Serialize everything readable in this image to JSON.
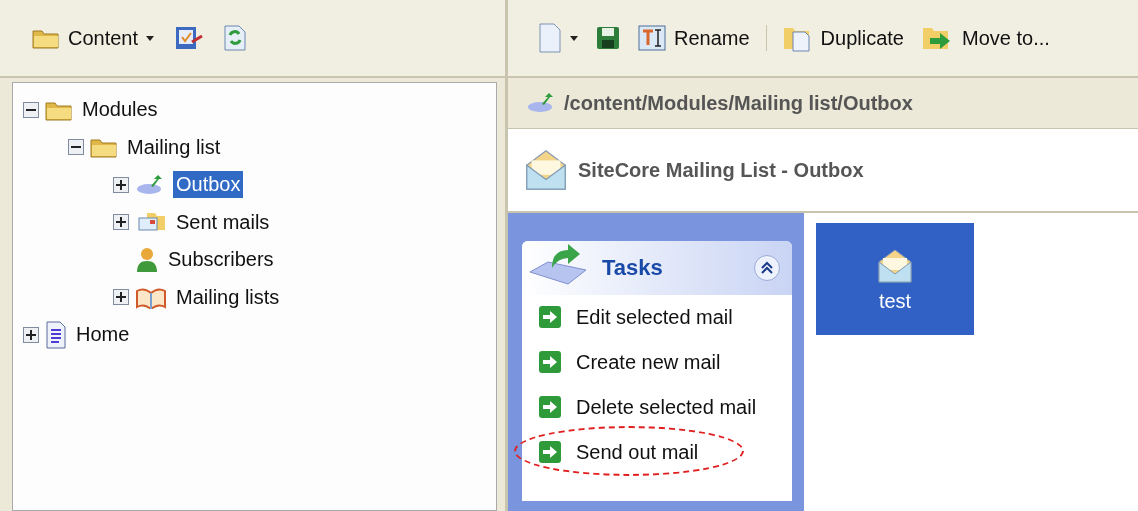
{
  "left_toolbar": {
    "content_menu": "Content"
  },
  "tree": [
    {
      "label": "Modules",
      "kind": "folder",
      "expanded": true,
      "selected": false,
      "children": [
        {
          "label": "Mailing list",
          "kind": "folder",
          "expanded": true,
          "selected": false,
          "children": [
            {
              "label": "Outbox",
              "kind": "outbox",
              "expanded": false,
              "selected": true
            },
            {
              "label": "Sent mails",
              "kind": "sent",
              "expanded": false,
              "selected": false
            },
            {
              "label": "Subscribers",
              "kind": "user",
              "selected": false
            },
            {
              "label": "Mailing lists",
              "kind": "book",
              "expanded": false,
              "selected": false
            }
          ]
        }
      ]
    },
    {
      "label": "Home",
      "kind": "page",
      "expanded": false,
      "selected": false
    }
  ],
  "right_toolbar": {
    "buttons": [
      {
        "kind": "new"
      },
      {
        "kind": "save"
      },
      {
        "kind": "rename",
        "label": "Rename"
      },
      {
        "kind": "duplicate",
        "label": "Duplicate"
      },
      {
        "kind": "move",
        "label": "Move to..."
      }
    ]
  },
  "path": "/content/Modules/Mailing list/Outbox",
  "header_title": "SiteCore Mailing List - Outbox",
  "tasks": {
    "title": "Tasks",
    "items": [
      {
        "label": "Edit selected mail",
        "highlighted": false
      },
      {
        "label": "Create new mail",
        "highlighted": false
      },
      {
        "label": "Delete selected mail",
        "highlighted": false
      },
      {
        "label": "Send out mail",
        "highlighted": true
      }
    ]
  },
  "items": [
    {
      "label": "test",
      "selected": true
    }
  ]
}
